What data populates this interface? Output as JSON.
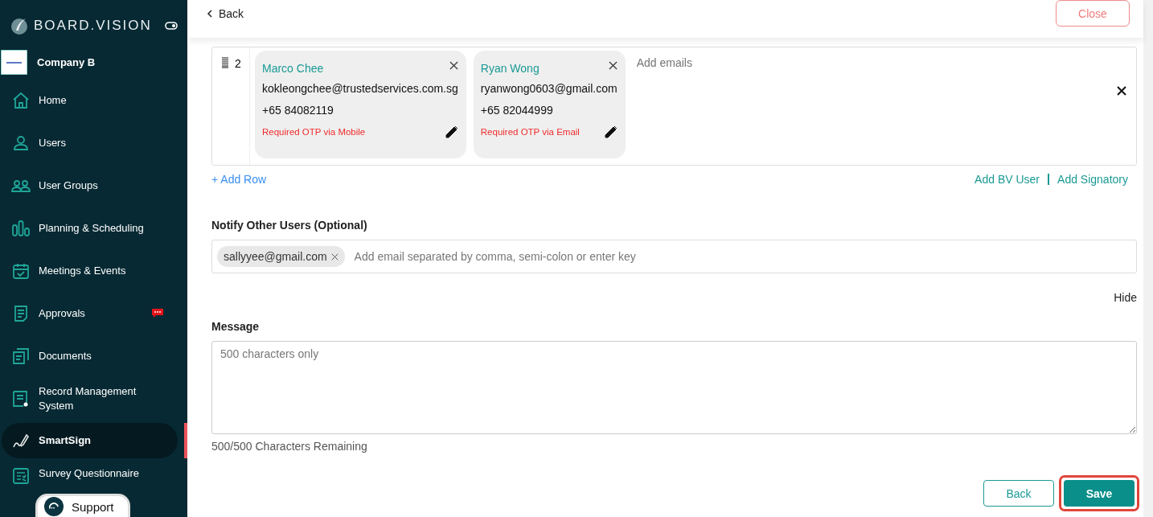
{
  "sidebar": {
    "brand": "BOARD.VISION",
    "company": "Company B",
    "items": [
      {
        "label": "Home",
        "kind": "home",
        "selected": false,
        "badge": false
      },
      {
        "label": "Users",
        "kind": "user",
        "selected": false,
        "badge": false
      },
      {
        "label": "User Groups",
        "kind": "group",
        "selected": false,
        "badge": false
      },
      {
        "label": "Planning & Scheduling",
        "kind": "bars",
        "selected": false,
        "badge": false
      },
      {
        "label": "Meetings & Events",
        "kind": "calendar",
        "selected": false,
        "badge": false
      },
      {
        "label": "Approvals",
        "kind": "doc",
        "selected": false,
        "badge": true
      },
      {
        "label": "Documents",
        "kind": "docs",
        "selected": false,
        "badge": false
      },
      {
        "label": "Record Management System",
        "kind": "record",
        "selected": false,
        "badge": false
      },
      {
        "label": "SmartSign",
        "kind": "pen",
        "selected": true,
        "badge": false
      },
      {
        "label": "Survey Questionnaire",
        "kind": "survey",
        "selected": false,
        "badge": false
      }
    ]
  },
  "support": {
    "label": "Support"
  },
  "header": {
    "back": "Back",
    "close": "Close"
  },
  "signatory_rows": [
    {
      "order": "2",
      "placeholder": "Add emails",
      "signatories": [
        {
          "name": "Marco Chee",
          "email": "kokleongchee@trustedservices.com.sg",
          "phone": "+65 84082119",
          "otp": "Required OTP via Mobile"
        },
        {
          "name": "Ryan Wong",
          "email": "ryanwong0603@gmail.com",
          "phone": "+65 82044999",
          "otp": "Required OTP via Email"
        }
      ]
    }
  ],
  "links": {
    "add_row": "+ Add Row",
    "add_bv_user": "Add BV User",
    "add_signatory": "Add Signatory"
  },
  "notify": {
    "label": "Notify Other Users (Optional)",
    "chips": [
      "sallyyee@gmail.com"
    ],
    "placeholder": "Add email separated by comma, semi-colon or enter key"
  },
  "hide": "Hide",
  "message": {
    "label": "Message",
    "placeholder": "500 characters only",
    "counter": "500/500 Characters Remaining"
  },
  "footer": {
    "back": "Back",
    "save": "Save",
    "save_focused": true
  }
}
